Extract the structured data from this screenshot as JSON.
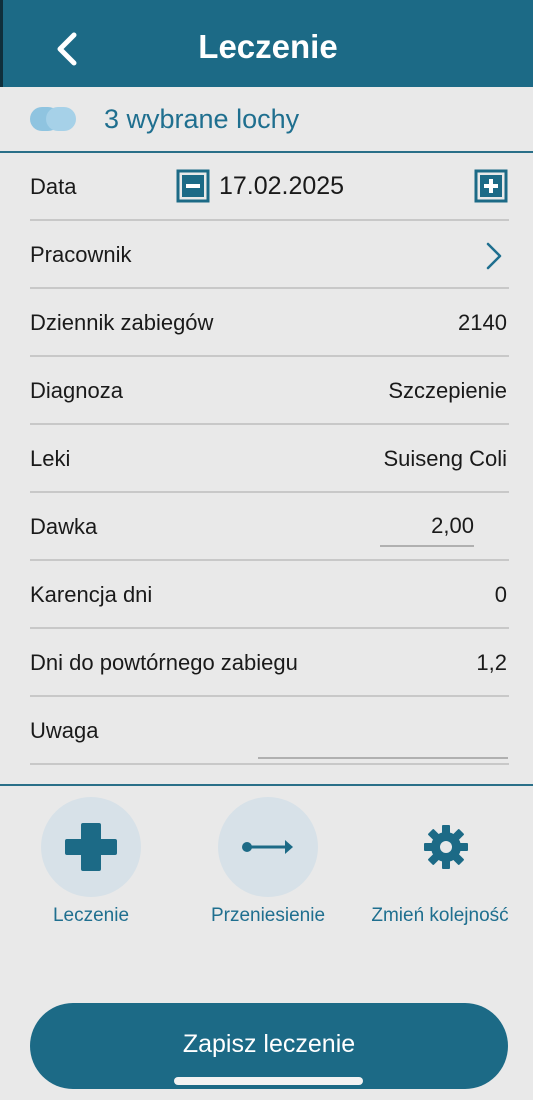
{
  "header": {
    "title": "Leczenie"
  },
  "selection": {
    "text": "3 wybrane lochy"
  },
  "rows": {
    "data": {
      "label": "Data",
      "value": "17.02.2025"
    },
    "pracownik": {
      "label": "Pracownik"
    },
    "dziennik": {
      "label": "Dziennik zabiegów",
      "value": "2140"
    },
    "diagnoza": {
      "label": "Diagnoza",
      "value": "Szczepienie"
    },
    "leki": {
      "label": "Leki",
      "value": "Suiseng Coli"
    },
    "dawka": {
      "label": "Dawka",
      "value": "2,00"
    },
    "karencja": {
      "label": "Karencja dni",
      "value": "0"
    },
    "powtorny": {
      "label": "Dni do powtórnego zabiegu",
      "value": "1,2"
    },
    "uwaga": {
      "label": "Uwaga",
      "value": ""
    }
  },
  "actions": {
    "leczenie": "Leczenie",
    "przeniesienie": "Przeniesienie",
    "zmien": "Zmień kolejność"
  },
  "save_button": "Zapisz leczenie",
  "colors": {
    "primary": "#1c6a86",
    "background": "#e9e9e9",
    "accent_light": "#d7e1e8",
    "pill": "#8fc4e0"
  },
  "icons": [
    "back-chevron-icon",
    "minus-square-icon",
    "plus-square-icon",
    "chevron-right-icon",
    "medical-cross-icon",
    "arrow-right-icon",
    "gear-icon"
  ]
}
